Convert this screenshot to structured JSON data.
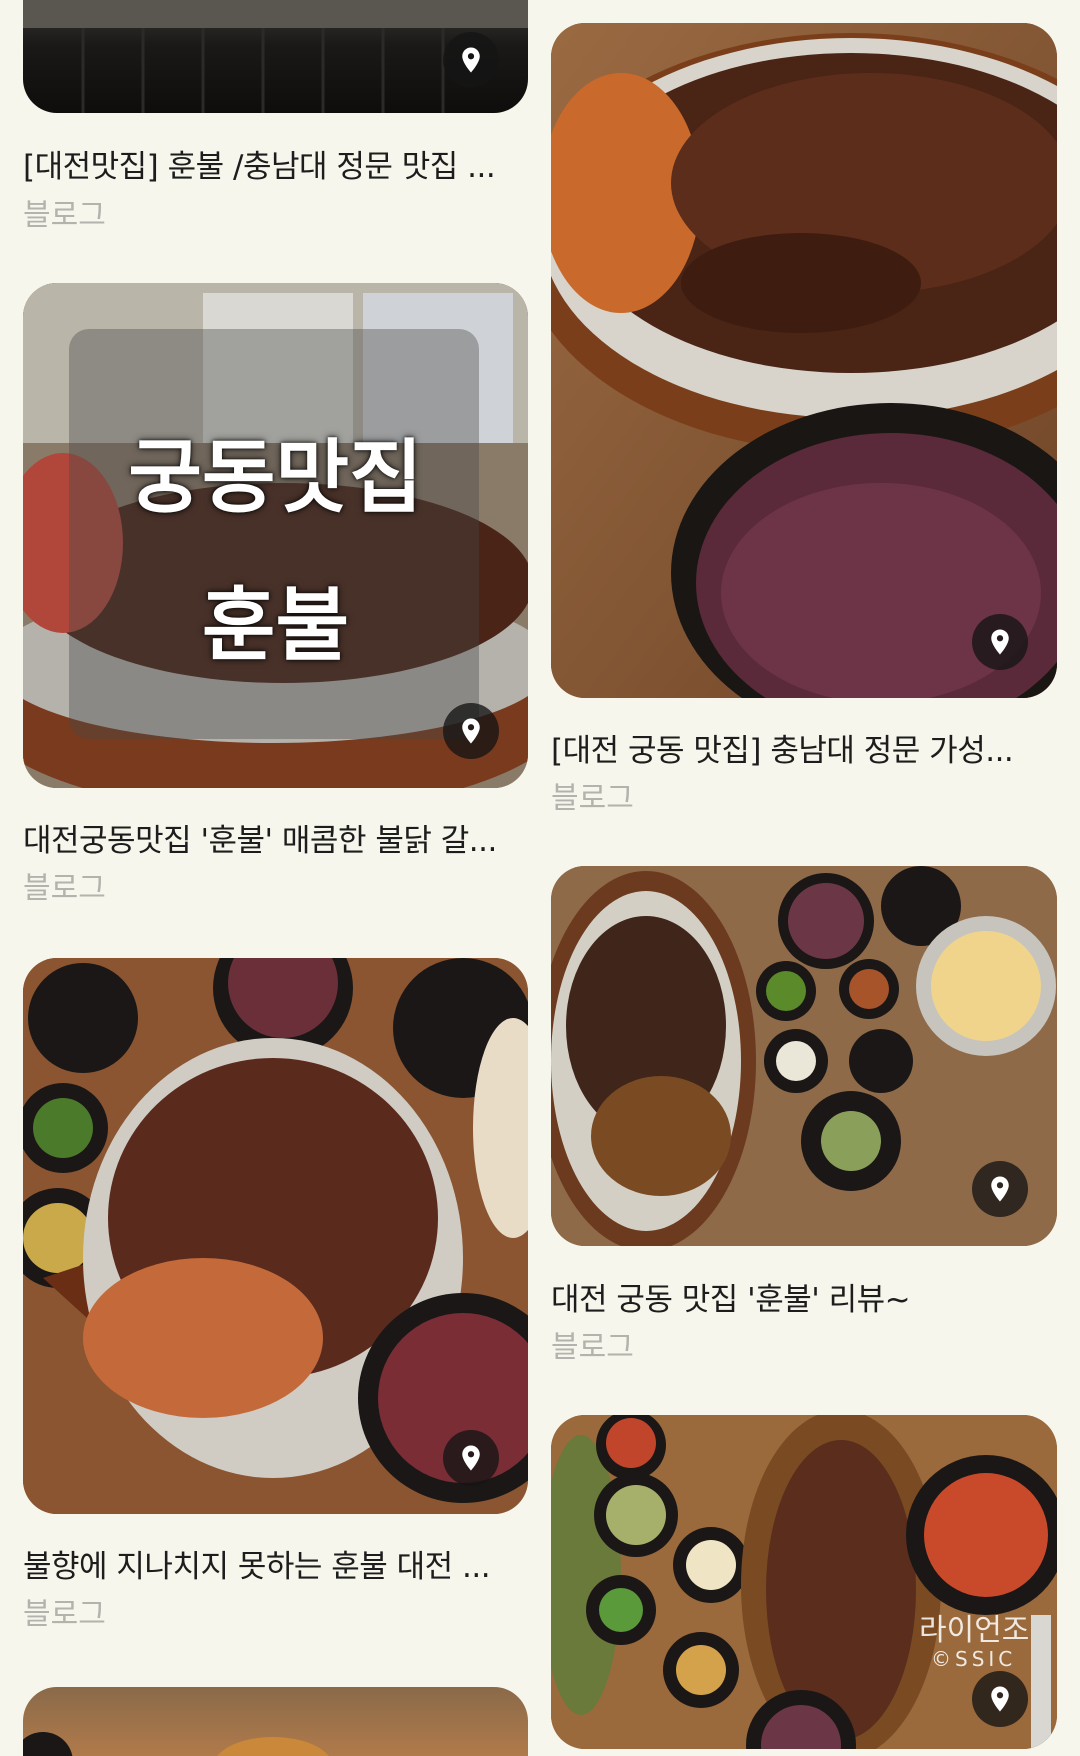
{
  "results": [
    {
      "title": "[대전맛집] 훈불 /충남대 정문 맛집 ...",
      "source": "블로그"
    },
    {
      "title": "[대전 궁동 맛집] 충남대 정문 가성...",
      "source": "블로그"
    },
    {
      "title": "대전궁동맛집 '훈불' 매콤한 불닭 갈...",
      "source": "블로그",
      "overlay_line1": "궁동맛집",
      "overlay_line2": "훈불"
    },
    {
      "title": "대전 궁동 맛집 '훈불' 리뷰~",
      "source": "블로그"
    },
    {
      "title": "불향에 지나치지 못하는 훈불 대전 ...",
      "source": "블로그"
    },
    {
      "title": "",
      "source": "",
      "watermark_name": "라이언조",
      "watermark_sub": "©SSIC"
    }
  ],
  "icons": {
    "location": "location-pin-icon"
  }
}
